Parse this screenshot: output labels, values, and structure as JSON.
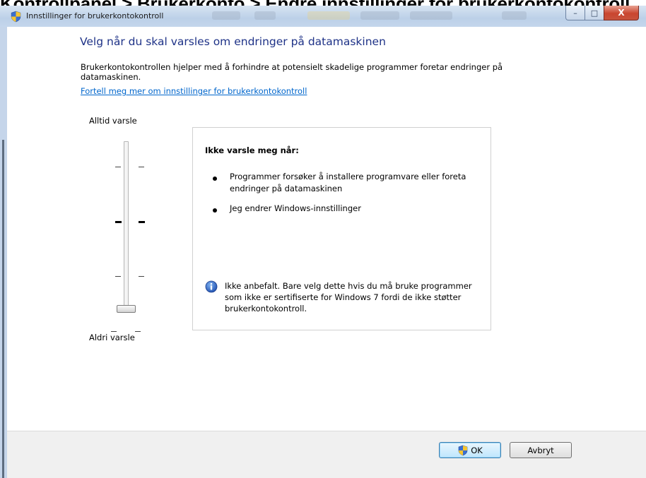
{
  "page_heading": "Kontrollpanel > Brukerkonto > Endre innstillinger for brukerkontokontroll",
  "window": {
    "title": "Innstillinger for brukerkontokontroll",
    "controls": {
      "minimize": "–",
      "maximize": "□",
      "close": "X"
    }
  },
  "main": {
    "heading": "Velg når du skal varsles om endringer på datamaskinen",
    "description": "Brukerkontokontrollen hjelper med å forhindre at potensielt skadelige programmer foretar endringer på datamaskinen.",
    "link": "Fortell meg mer om innstillinger for brukerkontokontroll"
  },
  "slider": {
    "top_label": "Alltid varsle",
    "bottom_label": "Aldri varsle",
    "levels": 4,
    "selected_level": 1
  },
  "info_panel": {
    "title": "Ikke varsle meg når:",
    "bullets": [
      "Programmer forsøker å installere programvare eller foreta endringer på datamaskinen",
      "Jeg endrer Windows-innstillinger"
    ],
    "note": "Ikke anbefalt. Bare velg dette hvis du må bruke programmer som ikke er sertifiserte for Windows 7 fordi de ikke støtter brukerkontokontroll."
  },
  "buttons": {
    "ok": "OK",
    "cancel": "Avbryt"
  },
  "icons": {
    "window": "uac-shield-icon",
    "info": "info-icon",
    "ok": "uac-shield-icon"
  },
  "colors": {
    "heading": "#1e3287",
    "link": "#0066cc",
    "window_frame": "#c5d5ea"
  }
}
